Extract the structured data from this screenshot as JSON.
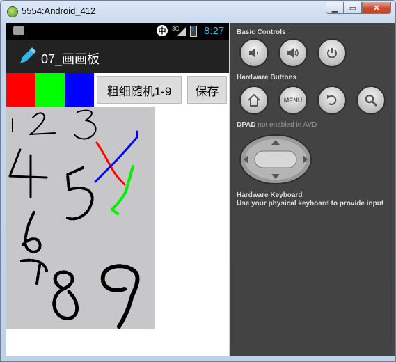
{
  "window": {
    "title": "5554:Android_412",
    "min_icon": "minimize-icon",
    "max_icon": "maximize-icon",
    "close_icon": "close-icon"
  },
  "statusbar": {
    "ime_label": "中",
    "signal_label": "3G",
    "clock": "8:27"
  },
  "app": {
    "title": "07_画画板",
    "icon": "pencil-icon"
  },
  "controls": {
    "colors": [
      "#ff0000",
      "#00ff00",
      "#0000ff"
    ],
    "stroke_button": "粗细随机1-9",
    "save_button": "保存"
  },
  "panel": {
    "basic_controls": "Basic Controls",
    "hardware_buttons": "Hardware Buttons",
    "menu_label": "MENU",
    "dpad_title": "DPAD",
    "dpad_note": "not enabled in AVD",
    "keyboard_title": "Hardware Keyboard",
    "keyboard_note": "Use your physical keyboard to provide input"
  }
}
